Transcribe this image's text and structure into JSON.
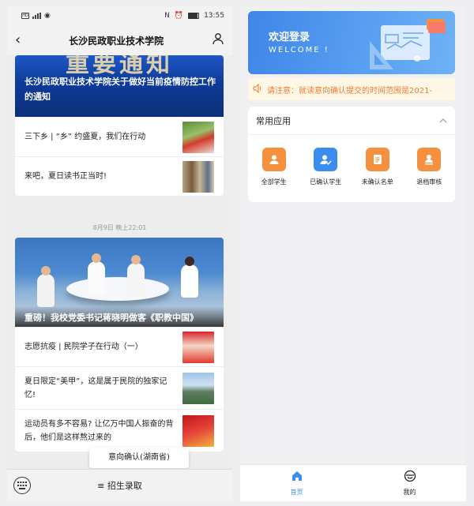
{
  "left": {
    "status": {
      "time": "13:55",
      "battery": "100"
    },
    "title": "长沙民政职业技术学院",
    "article1": {
      "banner_big": "重要通知",
      "banner_caption": "长沙民政职业技术学院关于做好当前疫情防控工作的通知",
      "items": [
        {
          "text": "三下乡 | “乡” 约盛夏，我们在行动"
        },
        {
          "text": "来吧，夏日读书正当时!"
        }
      ]
    },
    "timestamp": "8月9日 晚上22:01",
    "article2": {
      "banner_caption": "重磅！我校党委书记蒋晓明做客《职教中国》",
      "items": [
        {
          "text": "志愿抗疫 | 民院学子在行动（一）"
        },
        {
          "text": "夏日限定“美甲”，这是属于民院的独家记忆!"
        },
        {
          "text": "运动员有多不容易? 让亿万中国人振奋的背后，他们是这样熬过来的"
        }
      ]
    },
    "popup": "意向确认(湖南省)",
    "menu_label": "≡ 招生录取"
  },
  "right": {
    "hero": {
      "title": "欢迎登录",
      "subtitle": "WELCOME !"
    },
    "notice": "请注意：就读意向确认提交的时间范围是2021-",
    "section_title": "常用应用",
    "apps": [
      {
        "label": "全部学生",
        "color": "#f5913e"
      },
      {
        "label": "已确认学生",
        "color": "#3b8ef0"
      },
      {
        "label": "未确认名单",
        "color": "#f5913e"
      },
      {
        "label": "退档审核",
        "color": "#f5913e"
      }
    ],
    "tabs": [
      {
        "label": "首页",
        "active": true
      },
      {
        "label": "我的",
        "active": false
      }
    ],
    "colors": {
      "accent": "#3b8ef0",
      "orange": "#f5913e",
      "notice": "#f07b32"
    }
  }
}
